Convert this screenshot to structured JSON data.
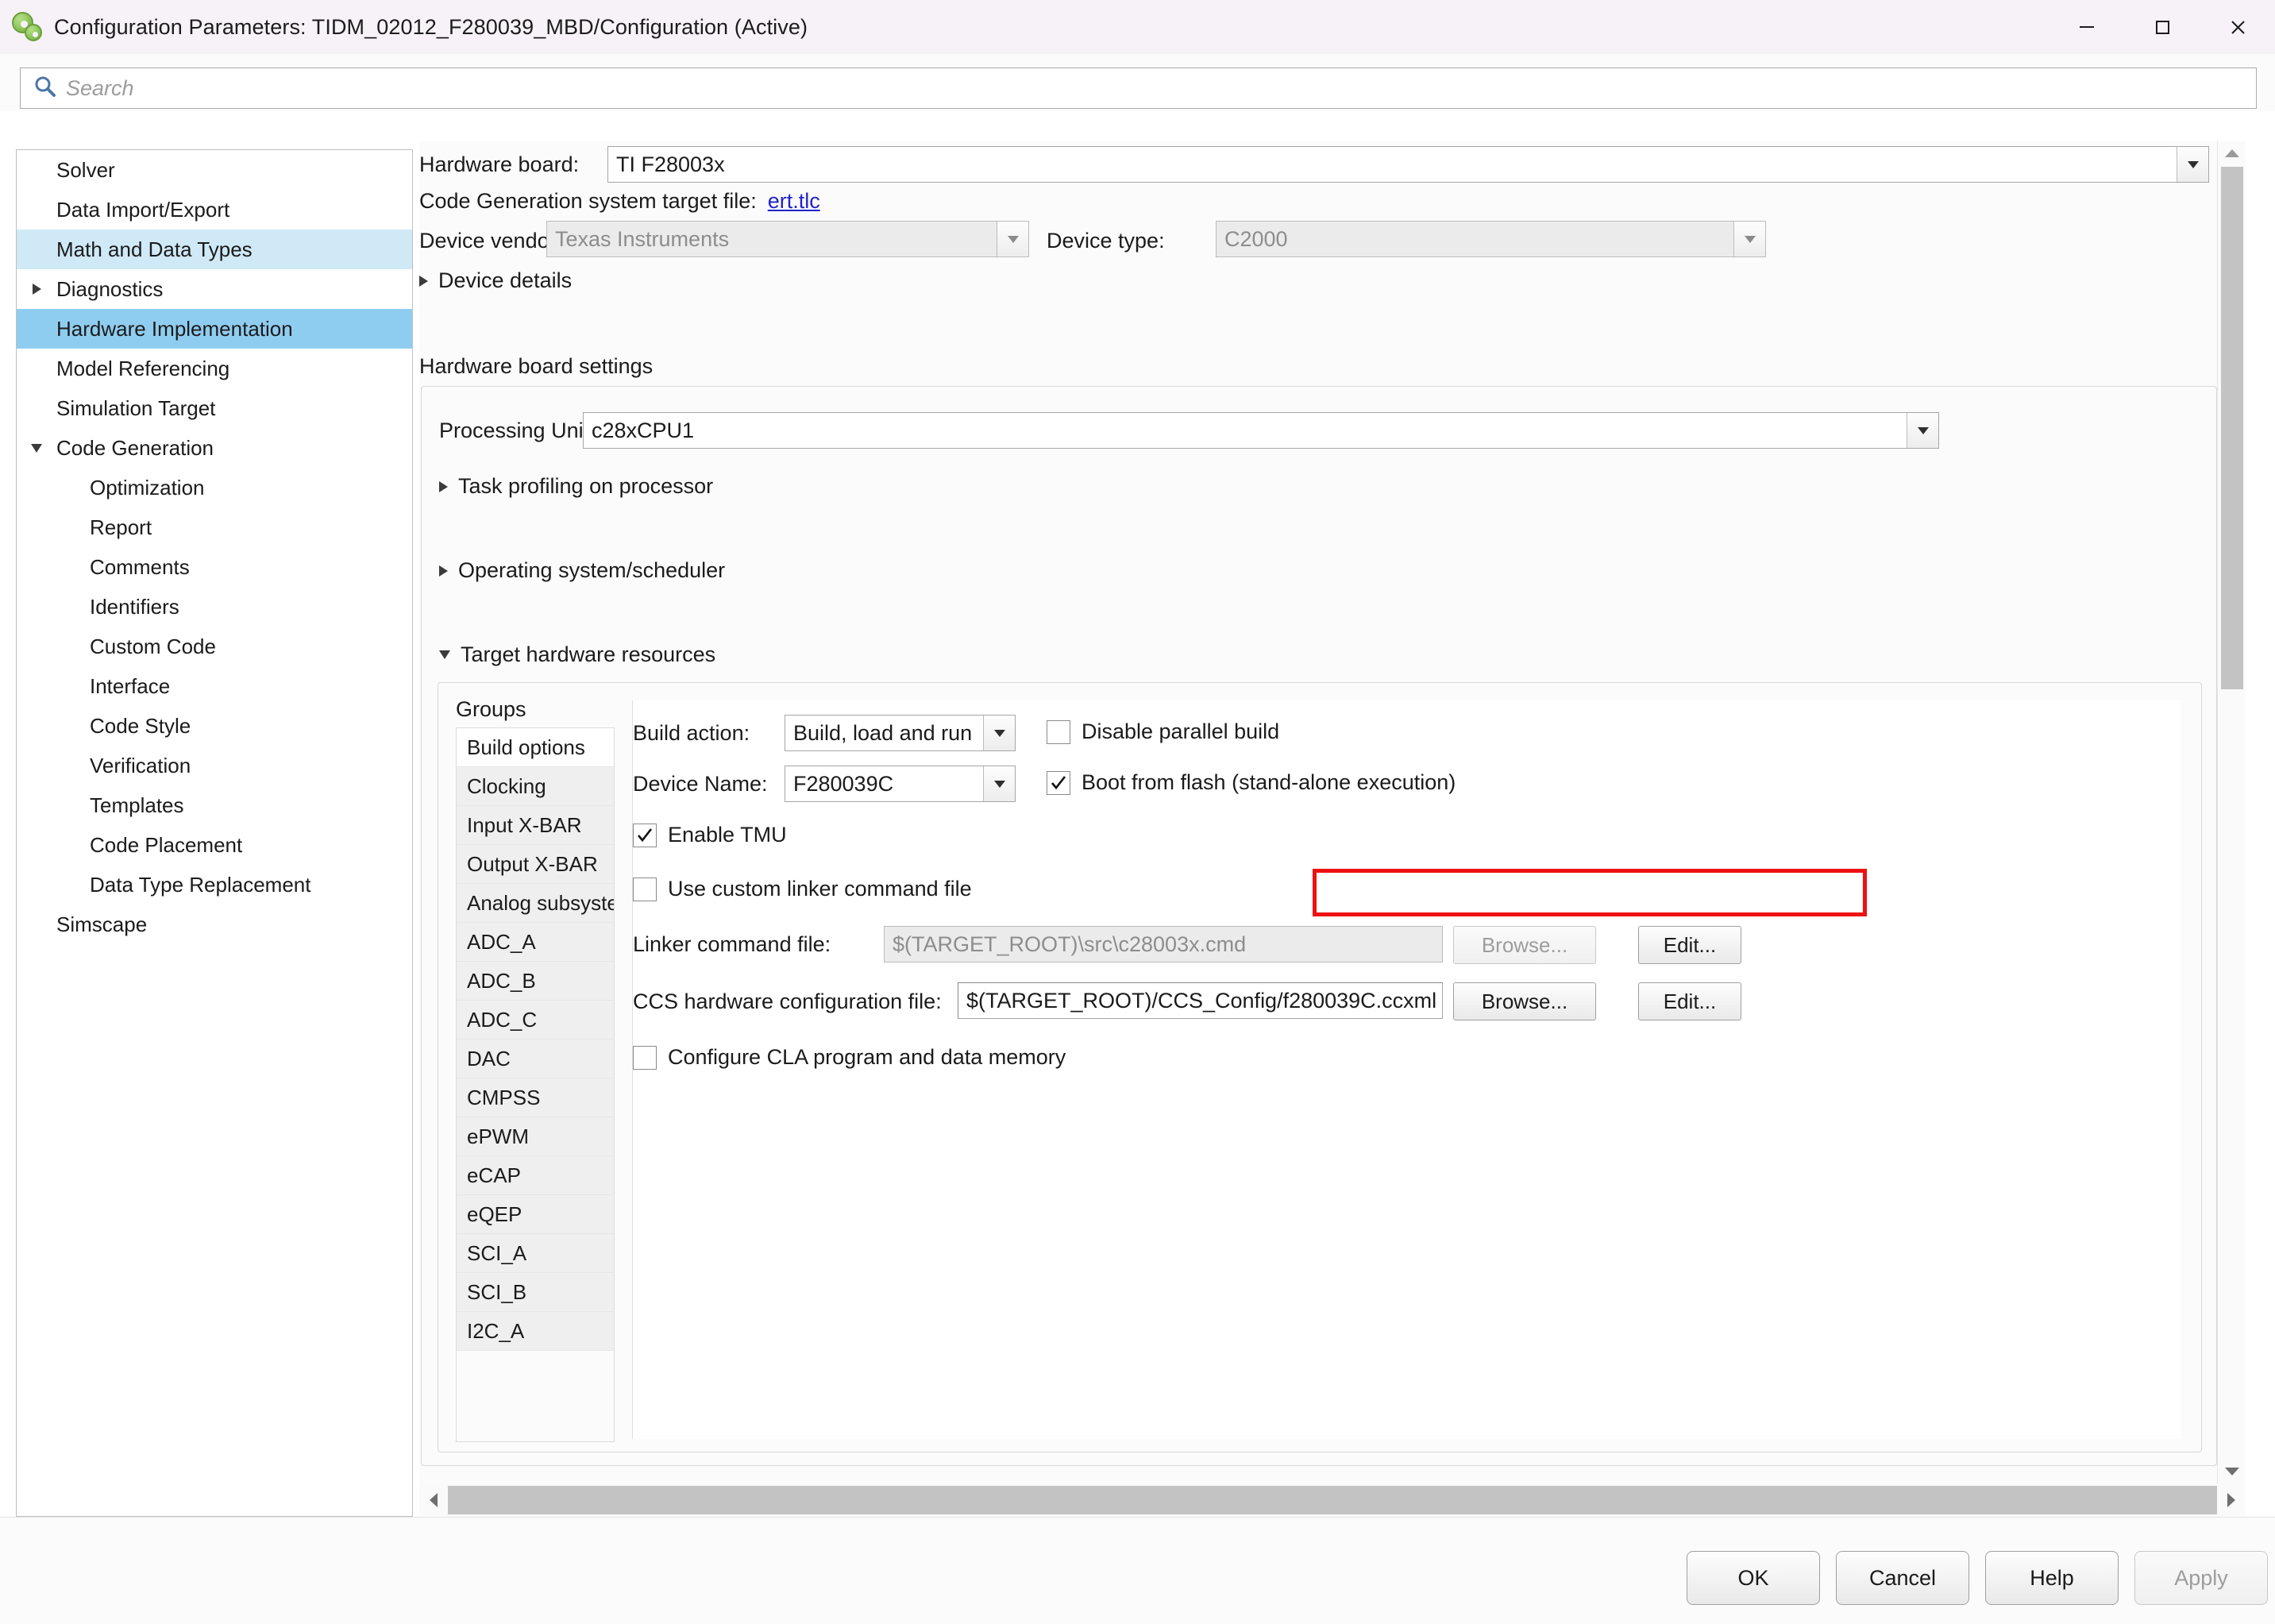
{
  "window": {
    "title": "Configuration Parameters: TIDM_02012_F280039_MBD/Configuration (Active)",
    "icon": "simulink-config-icon",
    "minimize_label": "Minimize",
    "maximize_label": "Maximize",
    "close_label": "Close"
  },
  "search": {
    "placeholder": "Search",
    "value": "",
    "icon": "search-icon"
  },
  "tree": {
    "items": [
      {
        "label": "Solver",
        "level": 0,
        "arrow": "none",
        "state": "normal"
      },
      {
        "label": "Data Import/Export",
        "level": 0,
        "arrow": "none",
        "state": "normal"
      },
      {
        "label": "Math and Data Types",
        "level": 0,
        "arrow": "none",
        "state": "soft-selected"
      },
      {
        "label": "Diagnostics",
        "level": 0,
        "arrow": "collapsed",
        "state": "normal"
      },
      {
        "label": "Hardware Implementation",
        "level": 0,
        "arrow": "none",
        "state": "selected"
      },
      {
        "label": "Model Referencing",
        "level": 0,
        "arrow": "none",
        "state": "normal"
      },
      {
        "label": "Simulation Target",
        "level": 0,
        "arrow": "none",
        "state": "normal"
      },
      {
        "label": "Code Generation",
        "level": 0,
        "arrow": "expanded",
        "state": "normal"
      },
      {
        "label": "Optimization",
        "level": 1,
        "arrow": "none",
        "state": "normal"
      },
      {
        "label": "Report",
        "level": 1,
        "arrow": "none",
        "state": "normal"
      },
      {
        "label": "Comments",
        "level": 1,
        "arrow": "none",
        "state": "normal"
      },
      {
        "label": "Identifiers",
        "level": 1,
        "arrow": "none",
        "state": "normal"
      },
      {
        "label": "Custom Code",
        "level": 1,
        "arrow": "none",
        "state": "normal"
      },
      {
        "label": "Interface",
        "level": 1,
        "arrow": "none",
        "state": "normal"
      },
      {
        "label": "Code Style",
        "level": 1,
        "arrow": "none",
        "state": "normal"
      },
      {
        "label": "Verification",
        "level": 1,
        "arrow": "none",
        "state": "normal"
      },
      {
        "label": "Templates",
        "level": 1,
        "arrow": "none",
        "state": "normal"
      },
      {
        "label": "Code Placement",
        "level": 1,
        "arrow": "none",
        "state": "normal"
      },
      {
        "label": "Data Type Replacement",
        "level": 1,
        "arrow": "none",
        "state": "normal"
      },
      {
        "label": "Simscape",
        "level": 0,
        "arrow": "none",
        "state": "normal"
      }
    ]
  },
  "main": {
    "hardware_board_label": "Hardware board:",
    "hardware_board_value": "TI F28003x",
    "systarget_label": "Code Generation system target file:",
    "systarget_link": "ert.tlc",
    "device_vendor_label": "Device vendor:",
    "device_vendor_value": "Texas Instruments",
    "device_type_label": "Device type:",
    "device_type_value": "C2000",
    "device_details_label": "Device details",
    "board_settings_label": "Hardware board settings",
    "processing_unit_label": "Processing Unit:",
    "processing_unit_value": "c28xCPU1",
    "task_profiling_label": "Task profiling on processor",
    "os_scheduler_label": "Operating system/scheduler",
    "target_hw_resources_label": "Target hardware resources"
  },
  "groups": {
    "header": "Groups",
    "selected": "Build options",
    "items": [
      "Build options",
      "Clocking",
      "Input X-BAR",
      "Output X-BAR",
      "Analog subsystem",
      "ADC_A",
      "ADC_B",
      "ADC_C",
      "DAC",
      "CMPSS",
      "ePWM",
      "eCAP",
      "eQEP",
      "SCI_A",
      "SCI_B",
      "I2C_A"
    ]
  },
  "build_options": {
    "build_action_label": "Build action:",
    "build_action_value": "Build, load and run",
    "disable_parallel_label": "Disable parallel build",
    "disable_parallel_checked": false,
    "device_name_label": "Device Name:",
    "device_name_value": "F280039C",
    "boot_from_flash_label": "Boot from flash (stand-alone execution)",
    "boot_from_flash_checked": true,
    "enable_tmu_label": "Enable TMU",
    "enable_tmu_checked": true,
    "custom_linker_label": "Use custom linker command file",
    "custom_linker_checked": false,
    "linker_cmd_label": "Linker command file:",
    "linker_cmd_value": "$(TARGET_ROOT)\\src\\c28003x.cmd",
    "linker_browse_label": "Browse...",
    "linker_edit_label": "Edit...",
    "ccs_label": "CCS hardware configuration file:",
    "ccs_value": "$(TARGET_ROOT)/CCS_Config/f280039C.ccxml",
    "ccs_browse_label": "Browse...",
    "ccs_edit_label": "Edit...",
    "configure_cla_label": "Configure CLA program and data memory",
    "configure_cla_checked": false
  },
  "highlight": {
    "color": "#ee1111",
    "target": "boot-from-flash-checkbox-row"
  },
  "footer": {
    "ok_label": "OK",
    "cancel_label": "Cancel",
    "help_label": "Help",
    "apply_label": "Apply",
    "apply_enabled": false
  }
}
